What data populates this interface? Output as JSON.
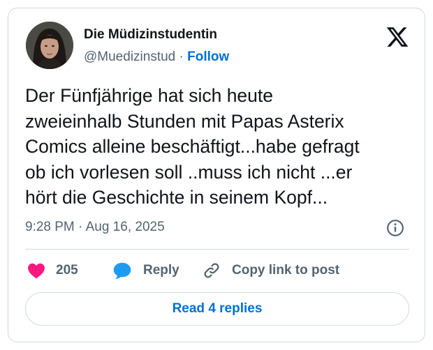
{
  "author": {
    "display_name": "Die Müdizinstudentin",
    "handle": "@Muedizinstud",
    "separator": "·",
    "follow_label": "Follow"
  },
  "tweet": {
    "text_lines": [
      "Der Fünfjährige hat sich heute",
      "zweieinhalb Stunden mit Papas Asterix",
      "Comics alleine beschäftigt...habe gefragt",
      "ob ich vorlesen soll ..muss ich nicht ...er",
      "hört die Geschichte in seinem Kopf..."
    ],
    "timestamp": "9:28 PM · Aug 16, 2025"
  },
  "actions": {
    "like_count": "205",
    "reply_label": "Reply",
    "copy_link_label": "Copy link to post"
  },
  "read_replies_label": "Read 4 replies",
  "icons": {
    "brand": "x-logo-icon",
    "like": "heart-icon",
    "reply": "speech-bubble-icon",
    "copy": "link-icon",
    "info": "info-icon"
  },
  "colors": {
    "like": "#f91880",
    "reply": "#1d9bf0",
    "link": "#006fd6",
    "secondary_text": "#536471",
    "border": "#cfd9de"
  }
}
